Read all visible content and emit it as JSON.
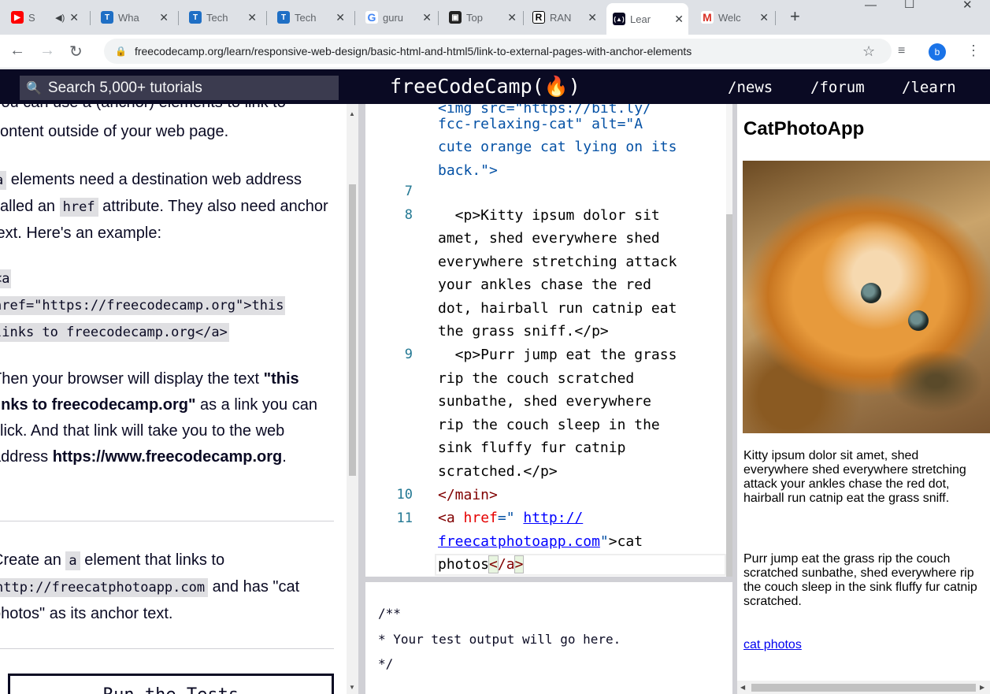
{
  "browser": {
    "tabs": [
      {
        "title": "S",
        "fav": "youtube-icon",
        "color": "#ff0000",
        "fav_text": "▶"
      },
      {
        "title": "Wha",
        "fav": "fcc-icon",
        "color": "#1f6fc5",
        "fav_text": "T"
      },
      {
        "title": "Tech",
        "fav": "fcc-icon",
        "color": "#1f6fc5",
        "fav_text": "T"
      },
      {
        "title": "Tech",
        "fav": "fcc-icon",
        "color": "#1f6fc5",
        "fav_text": "T"
      },
      {
        "title": "guru",
        "fav": "google-icon",
        "color": "#ffffff",
        "fav_text": "G"
      },
      {
        "title": "Top",
        "fav": "video-icon",
        "color": "#222222",
        "fav_text": "▣"
      },
      {
        "title": "RAN",
        "fav": "r-icon",
        "color": "#ffffff",
        "fav_text": "R"
      },
      {
        "title": "Lear",
        "fav": "fcc-dark-icon",
        "color": "#0a0a23",
        "fav_text": "(🔥)"
      },
      {
        "title": "Welc",
        "fav": "gmail-icon",
        "color": "#ffffff",
        "fav_text": "M"
      }
    ],
    "url": "freecodecamp.org/learn/responsive-web-design/basic-html-and-html5/link-to-external-pages-with-anchor-elements",
    "profile_initial": "b"
  },
  "nav": {
    "search_placeholder": "Search 5,000+ tutorials",
    "logo": "freeCodeCamp(🔥)",
    "links": [
      "/news",
      "/forum",
      "/learn"
    ]
  },
  "instructions": {
    "p0_cut": "You can use a (anchor) elements to link to",
    "p0_line2": "content outside of your web page.",
    "p1_code": "a",
    "p1_a": " elements need a destination web address called an ",
    "p1_href": "href",
    "p1_b": " attribute. They also need anchor text. Here's an example:",
    "example_lines": [
      "<a",
      "href=\"https://freecodecamp.org\">this",
      "links to freecodecamp.org</a>"
    ],
    "p2_a": "Then your browser will display the text ",
    "p2_bold": "\"this links to freecodecamp.org\"",
    "p2_b": " as a link you can click. And that link will take you to the web address ",
    "p2_url": "https://www.freecodecamp.org",
    "p2_end": ".",
    "task_a": "Create an ",
    "task_code": "a",
    "task_b": " element that links to ",
    "task_url": "http://freecatphotoapp.com",
    "task_c": " and has \"cat photos\" as its anchor text.",
    "run_button": "Run the Tests"
  },
  "editor": {
    "line_numbers": [
      "7",
      "8",
      "9",
      "10",
      "11"
    ],
    "top_lines": [
      "fcc-relaxing-cat\" alt=\"A",
      "cute orange cat lying on its",
      "back.\">"
    ],
    "p1_lines": [
      "  <p>Kitty ipsum dolor sit",
      "amet, shed everywhere shed",
      "everywhere stretching attack",
      "your ankles chase the red",
      "dot, hairball run catnip eat",
      "the grass sniff.</p>"
    ],
    "p2_lines": [
      "  <p>Purr jump eat the grass",
      "rip the couch scratched",
      "sunbathe, shed everywhere",
      "rip the couch sleep in the",
      "sink fluffy fur catnip",
      "scratched.</p>"
    ],
    "line10": "</main>",
    "line11_a": "<a ",
    "line11_attr": "href",
    "line11_eq": "=\" ",
    "line11_url1": "http://",
    "line11_url2": "freecatphotoapp.com",
    "line11_b": "\">cat",
    "line11_c": "photos",
    "line11_d": "</a",
    "line11_e": ">"
  },
  "output": {
    "lines": [
      "/**",
      "* Your test output will go here.",
      "*/"
    ]
  },
  "preview": {
    "heading": "CatPhotoApp",
    "image_alt": "A cute orange cat lying on its back.",
    "p1": "Kitty ipsum dolor sit amet, shed everywhere shed everywhere stretching attack your ankles chase the red dot, hairball run catnip eat the grass sniff.",
    "p2": "Purr jump eat the grass rip the couch scratched sunbathe, shed everywhere rip the couch sleep in the sink fluffy fur catnip scratched.",
    "link": "cat photos"
  }
}
